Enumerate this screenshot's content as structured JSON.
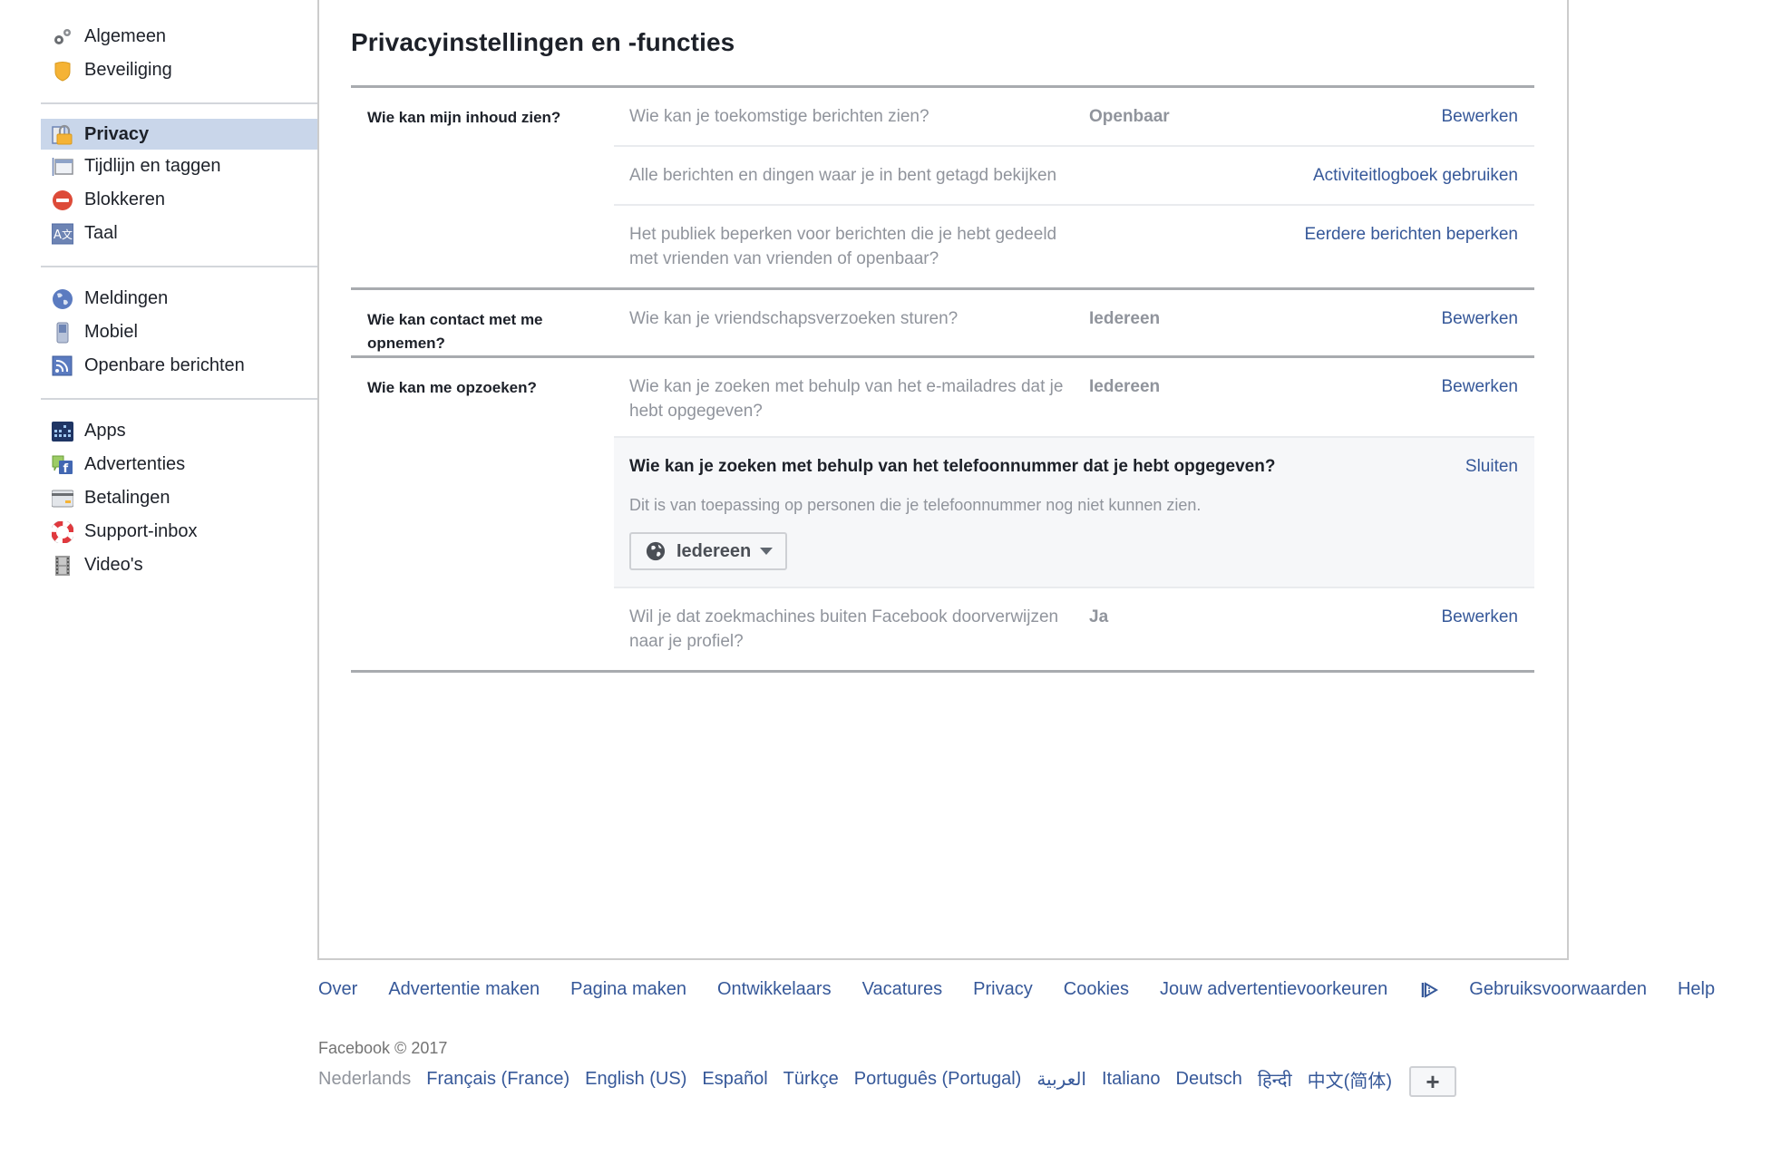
{
  "sidebar": {
    "groups": [
      [
        {
          "label": "Algemeen",
          "icon": "gears-icon"
        },
        {
          "label": "Beveiliging",
          "icon": "security-badge-icon"
        }
      ],
      [
        {
          "label": "Privacy",
          "icon": "privacy-lock-icon",
          "active": true
        },
        {
          "label": "Tijdlijn en taggen",
          "icon": "timeline-icon"
        },
        {
          "label": "Blokkeren",
          "icon": "block-icon"
        },
        {
          "label": "Taal",
          "icon": "language-icon"
        }
      ],
      [
        {
          "label": "Meldingen",
          "icon": "globe-notifications-icon"
        },
        {
          "label": "Mobiel",
          "icon": "mobile-phone-icon"
        },
        {
          "label": "Openbare berichten",
          "icon": "rss-feed-icon"
        }
      ],
      [
        {
          "label": "Apps",
          "icon": "apps-grid-icon"
        },
        {
          "label": "Advertenties",
          "icon": "ads-icon"
        },
        {
          "label": "Betalingen",
          "icon": "credit-card-icon"
        },
        {
          "label": "Support-inbox",
          "icon": "lifebuoy-icon"
        },
        {
          "label": "Video's",
          "icon": "film-icon"
        }
      ]
    ]
  },
  "main": {
    "title": "Privacyinstellingen en -functies",
    "sections": [
      {
        "label": "Wie kan mijn inhoud zien?",
        "rows": [
          {
            "question": "Wie kan je toekomstige berichten zien?",
            "value": "Openbaar",
            "action": "Bewerken"
          },
          {
            "question": "Alle berichten en dingen waar je in bent getagd bekijken",
            "value": "",
            "action": "Activiteitlogboek gebruiken"
          },
          {
            "question": "Het publiek beperken voor berichten die je hebt gedeeld met vrienden van vrienden of openbaar?",
            "value": "",
            "action": "Eerdere berichten beperken"
          }
        ]
      },
      {
        "label": "Wie kan contact met me opnemen?",
        "rows": [
          {
            "question": "Wie kan je vriendschapsverzoeken sturen?",
            "value": "Iedereen",
            "action": "Bewerken"
          }
        ]
      },
      {
        "label": "Wie kan me opzoeken?",
        "rows": [
          {
            "question": "Wie kan je zoeken met behulp van het e-mailadres dat je hebt opgegeven?",
            "value": "Iedereen",
            "action": "Bewerken"
          },
          {
            "expanded": true,
            "question": "Wie kan je zoeken met behulp van het telefoonnummer dat je hebt opgegeven?",
            "action": "Sluiten",
            "description": "Dit is van toepassing op personen die je telefoonnummer nog niet kunnen zien.",
            "selected": "Iedereen"
          },
          {
            "question": "Wil je dat zoekmachines buiten Facebook doorverwijzen naar je profiel?",
            "value": "Ja",
            "action": "Bewerken"
          }
        ]
      }
    ]
  },
  "footer": {
    "links": [
      "Over",
      "Advertentie maken",
      "Pagina maken",
      "Ontwikkelaars",
      "Vacatures",
      "Privacy",
      "Cookies",
      "Jouw advertentievoorkeuren",
      "Gebruiksvoorwaarden",
      "Help"
    ],
    "copyright": "Facebook © 2017",
    "current_language": "Nederlands",
    "languages": [
      "Français (France)",
      "English (US)",
      "Español",
      "Türkçe",
      "Português (Portugal)",
      "العربية",
      "Italiano",
      "Deutsch",
      "हिन्दी",
      "中文(简体)"
    ],
    "more_languages_label": "+"
  },
  "colors": {
    "link": "#365899",
    "active_nav_bg": "#c9d6ea",
    "muted_text": "#90949c",
    "expanded_bg": "#f6f7f9"
  }
}
